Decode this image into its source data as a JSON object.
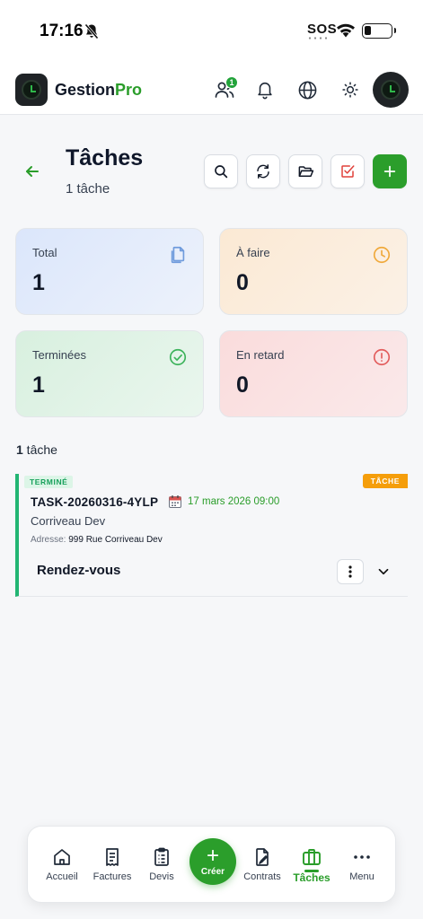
{
  "status_bar": {
    "time": "17:16",
    "sos": "SOS",
    "battery_level": 0.25
  },
  "app": {
    "brand_main": "Gestion",
    "brand_accent": "Pro",
    "accent_color": "#2a9d2a",
    "team_badge_count": "1"
  },
  "header_icons": [
    "team-icon",
    "bell-icon",
    "globe-icon",
    "sun-icon"
  ],
  "page": {
    "title": "Tâches",
    "subtitle": "1 tâche"
  },
  "toolbar": [
    "search-icon",
    "refresh-icon",
    "folder-open-icon",
    "check-square-icon",
    "plus-icon"
  ],
  "stats": [
    {
      "label": "Total",
      "value": "1",
      "icon": "document-icon",
      "color": "#6f9bdc"
    },
    {
      "label": "À faire",
      "value": "0",
      "icon": "clock-icon",
      "color": "#f0a93b"
    },
    {
      "label": "Terminées",
      "value": "1",
      "icon": "check-circle-icon",
      "color": "#3cb35a"
    },
    {
      "label": "En retard",
      "value": "0",
      "icon": "alert-circle-icon",
      "color": "#e25c5c"
    }
  ],
  "list": {
    "count_num": "1",
    "count_word": " tâche",
    "tasks": [
      {
        "status": "TERMINÉ",
        "type": "TÂCHE",
        "id": "TASK-20260316-4YLP",
        "date": "17 mars 2026 09:00",
        "client": "Corriveau Dev",
        "address_label": "Adresse:",
        "address": "999 Rue Corriveau Dev",
        "kind": "Rendez-vous"
      }
    ]
  },
  "bottom_nav": {
    "items": [
      "Accueil",
      "Factures",
      "Devis",
      "Contrats",
      "Tâches",
      "Menu"
    ],
    "create_label": "Créer",
    "active": "Tâches"
  }
}
